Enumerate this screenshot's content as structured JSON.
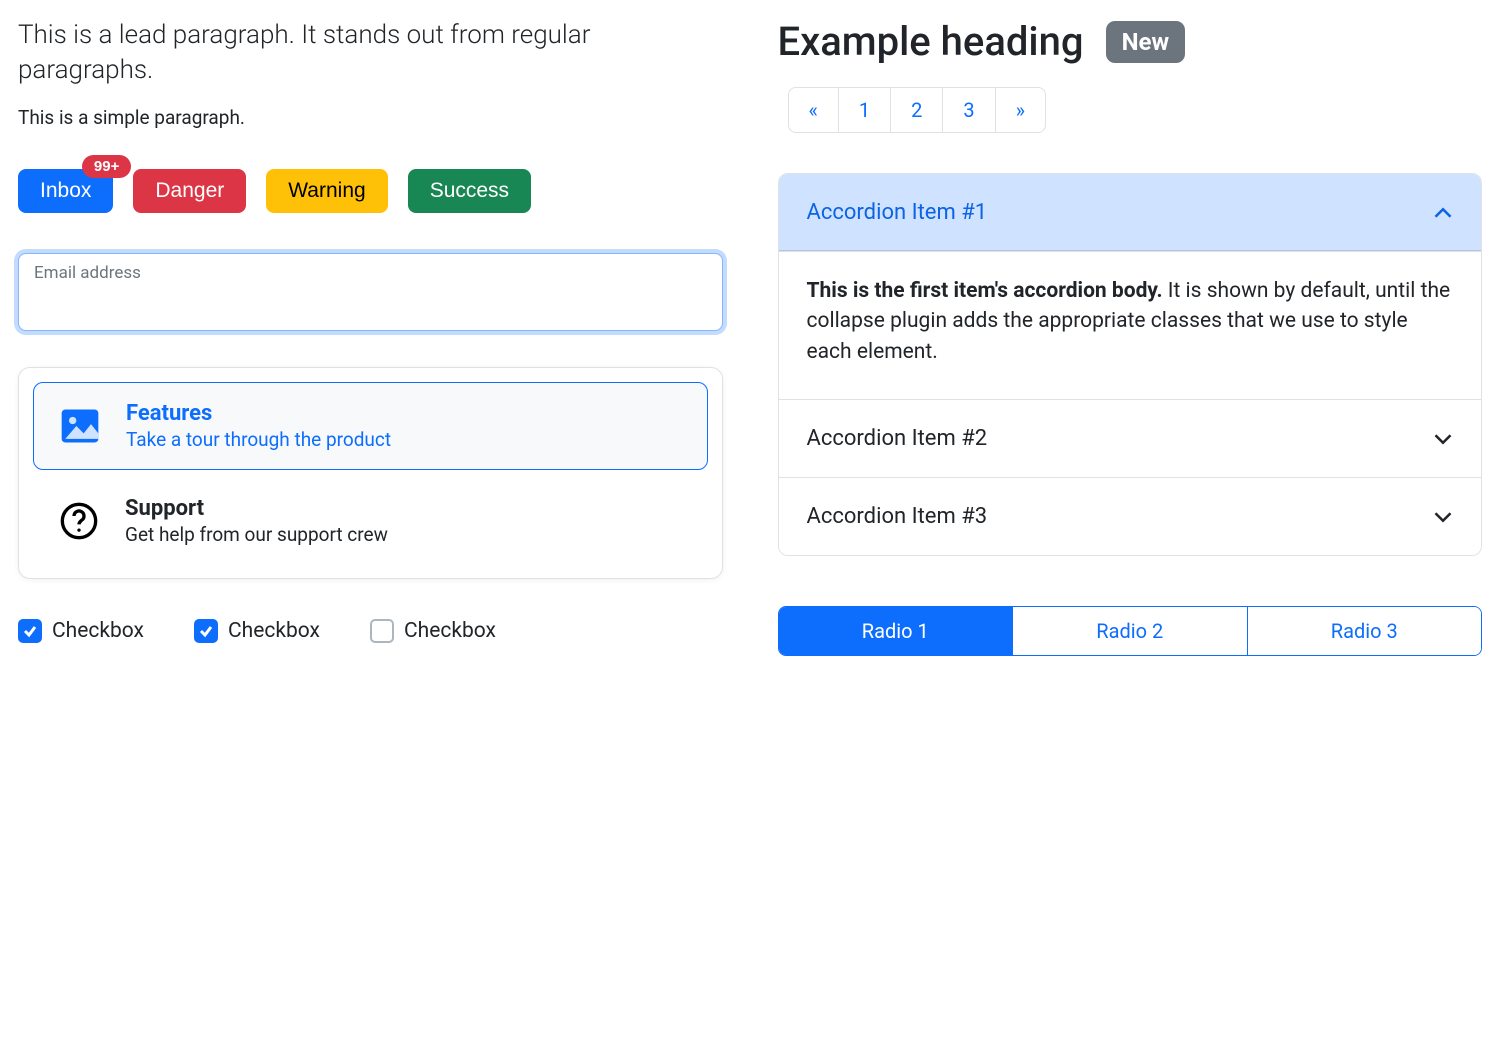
{
  "left": {
    "lead": "This is a lead paragraph. It stands out from regular paragraphs.",
    "para": "This is a simple paragraph.",
    "buttons": {
      "inbox": "Inbox",
      "inbox_badge": "99+",
      "danger": "Danger",
      "warning": "Warning",
      "success": "Success"
    },
    "email_label": "Email address",
    "list": [
      {
        "title": "Features",
        "sub": "Take a tour through the product",
        "active": true
      },
      {
        "title": "Support",
        "sub": "Get help from our support crew",
        "active": false
      }
    ],
    "checks": [
      {
        "label": "Checkbox",
        "checked": true
      },
      {
        "label": "Checkbox",
        "checked": true
      },
      {
        "label": "Checkbox",
        "checked": false
      }
    ]
  },
  "right": {
    "heading": "Example heading",
    "badge": "New",
    "pages": [
      "1",
      "2",
      "3"
    ],
    "accordion": [
      {
        "title": "Accordion Item #1",
        "open": true,
        "body_strong": "This is the first item's accordion body.",
        "body_rest": " It is shown by default, until the collapse plugin adds the appropriate classes that we use to style each element."
      },
      {
        "title": "Accordion Item #2",
        "open": false
      },
      {
        "title": "Accordion Item #3",
        "open": false
      }
    ],
    "radios": [
      "Radio 1",
      "Radio 2",
      "Radio 3"
    ],
    "radio_active": 0
  }
}
